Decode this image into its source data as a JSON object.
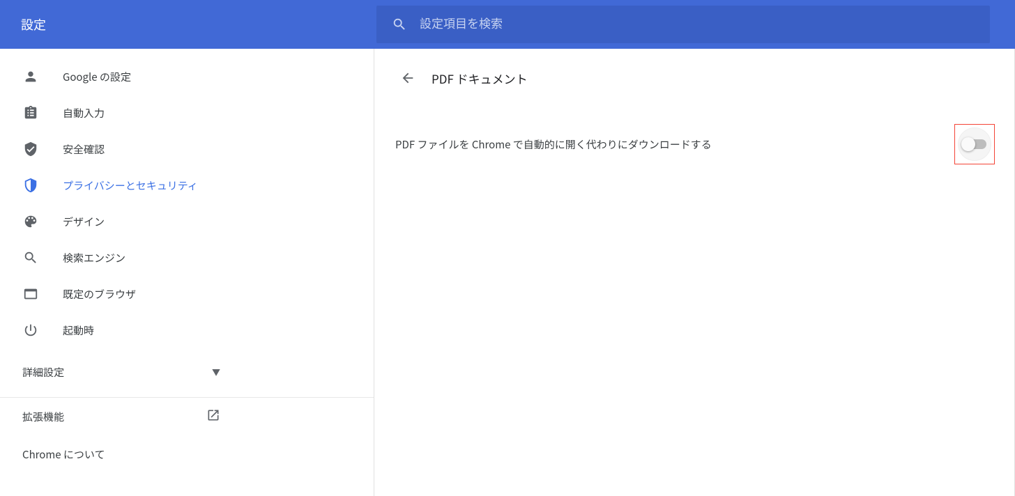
{
  "header": {
    "title": "設定",
    "search_placeholder": "設定項目を検索"
  },
  "sidebar": {
    "items": [
      {
        "label": "Google の設定",
        "icon": "person-icon",
        "active": false
      },
      {
        "label": "自動入力",
        "icon": "clipboard-icon",
        "active": false
      },
      {
        "label": "安全確認",
        "icon": "shield-check-icon",
        "active": false
      },
      {
        "label": "プライバシーとセキュリティ",
        "icon": "shield-icon",
        "active": true
      },
      {
        "label": "デザイン",
        "icon": "palette-icon",
        "active": false
      },
      {
        "label": "検索エンジン",
        "icon": "search-icon",
        "active": false
      },
      {
        "label": "既定のブラウザ",
        "icon": "browser-icon",
        "active": false
      },
      {
        "label": "起動時",
        "icon": "power-icon",
        "active": false
      }
    ],
    "advanced_label": "詳細設定",
    "extensions_label": "拡張機能",
    "about_label": "Chrome について"
  },
  "content": {
    "page_title": "PDF ドキュメント",
    "setting_label": "PDF ファイルを Chrome で自動的に開く代わりにダウンロードする",
    "toggle_on": false
  }
}
